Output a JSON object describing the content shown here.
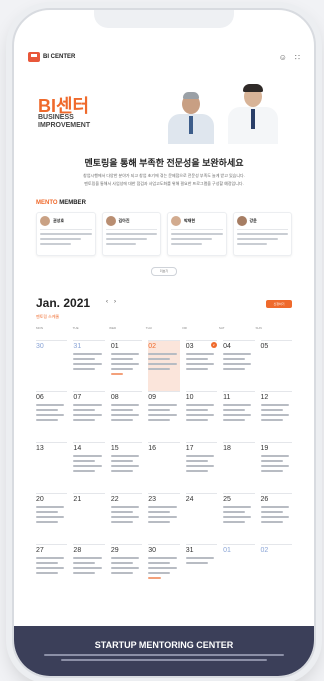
{
  "header": {
    "logo_text": "BI CENTER",
    "icons": [
      "profile-icon",
      "grid-menu-icon"
    ]
  },
  "hero": {
    "title": "BI센터",
    "subtitle_line1": "BUSINESS",
    "subtitle_line2": "IMPROVEMENT"
  },
  "intro": {
    "title": "멘토링을 통해 부족한 전문성을 보완하세요",
    "line1": "창업시행에서 다양한 분야가 되고 창업 초기에 겪는 문제점으로 전문성 부족도 늘게 받고 있습니다.",
    "line2": "멘토링을 통해서 사업성에 대한 점검과 사업고도화를 위해 필요한 프로그램을 구성할 예정입니다."
  },
  "mentors_section": {
    "label_highlight": "MENTO",
    "label_rest": " MEMBER",
    "more_label": "더보기"
  },
  "mentors": [
    {
      "name": "권성호"
    },
    {
      "name": "김아진"
    },
    {
      "name": "박재현"
    },
    {
      "name": "강윤"
    }
  ],
  "calendar": {
    "month_label": "Jan. 2021",
    "nav_prev": "‹",
    "nav_next": "›",
    "subtitle": "멘토링 스케줄",
    "cta_label": "신청하기",
    "weekdays": [
      "MON",
      "TUE",
      "WED",
      "THU",
      "FRI",
      "SAT",
      "SUN"
    ],
    "weeks": [
      [
        "30",
        "31",
        "01",
        "02",
        "03",
        "04",
        "05"
      ],
      [
        "06",
        "07",
        "08",
        "09",
        "10",
        "11",
        "12"
      ],
      [
        "13",
        "14",
        "15",
        "16",
        "17",
        "18",
        "19"
      ],
      [
        "20",
        "21",
        "22",
        "23",
        "24",
        "25",
        "26"
      ],
      [
        "27",
        "28",
        "29",
        "30",
        "31",
        "01",
        "02"
      ]
    ],
    "badge": "2"
  },
  "footer": {
    "title": "STARTUP MENTORING CENTER"
  },
  "colors": {
    "accent": "#ef6a2c",
    "footer_bg": "#3b3f59",
    "highlight": "#fbe5db"
  }
}
